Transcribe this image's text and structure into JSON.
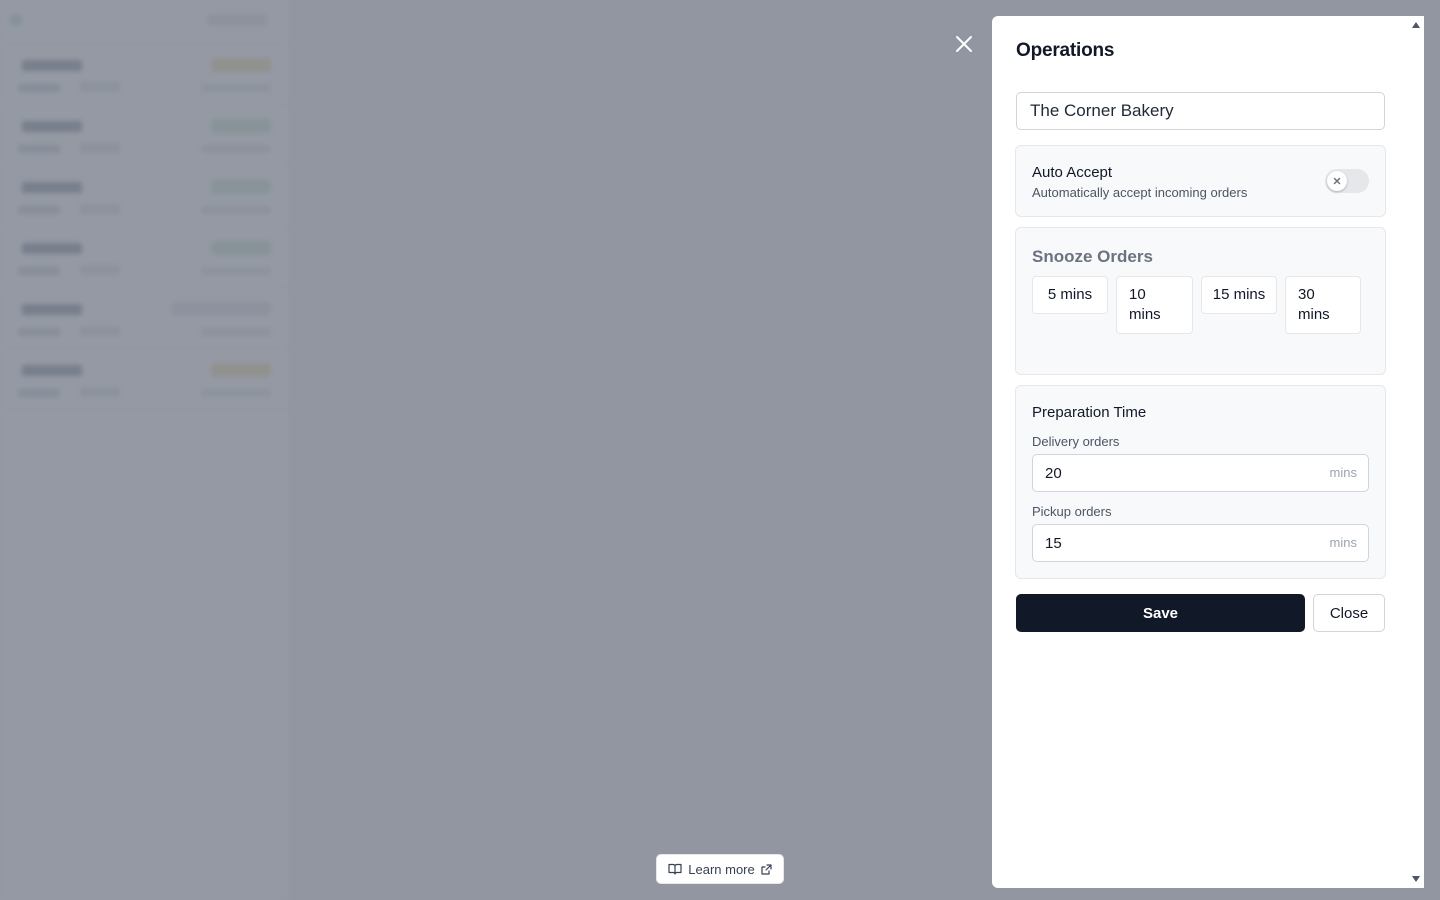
{
  "drawer": {
    "title": "Operations",
    "store_name": "The Corner Bakery",
    "auto_accept": {
      "title": "Auto Accept",
      "subtitle": "Automatically accept incoming orders",
      "enabled": false
    },
    "snooze": {
      "title": "Snooze Orders",
      "options": [
        "5 mins",
        "10 mins",
        "15 mins",
        "30 mins"
      ]
    },
    "preparation": {
      "title": "Preparation Time",
      "delivery_label": "Delivery orders",
      "delivery_value": "20",
      "pickup_label": "Pickup orders",
      "pickup_value": "15",
      "unit": "mins"
    },
    "save_label": "Save",
    "close_label": "Close"
  },
  "footer": {
    "learn_more_label": "Learn more"
  },
  "icons": {
    "overlay_close": "close-icon",
    "toggle_off": "x-icon",
    "learn_more": "book-open-icon",
    "learn_more_external": "external-link-icon"
  },
  "colors": {
    "primary_button": "#111827",
    "overlay": "#6b7280",
    "card_background": "#f8f9fb"
  }
}
